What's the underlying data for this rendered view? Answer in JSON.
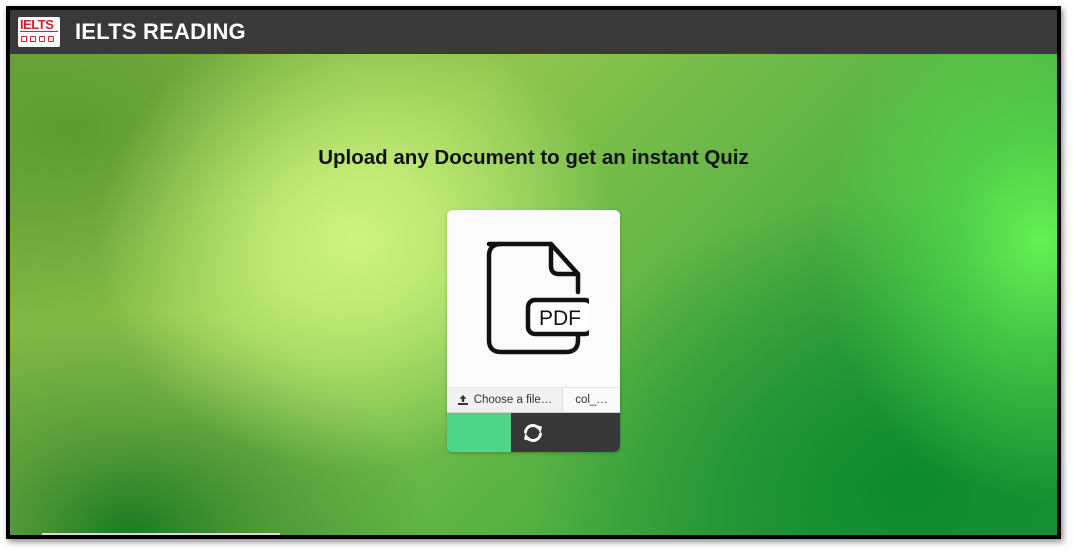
{
  "header": {
    "logo_text": "IELTS",
    "title": "IELTS READING"
  },
  "main": {
    "headline": "Upload any Document to get an instant Quiz"
  },
  "upload_card": {
    "preview_icon": "pdf-file-icon",
    "preview_label": "PDF",
    "choose_button_label": "Choose a file…",
    "choose_button_icon": "upload-icon",
    "selected_file_name": "col_…",
    "submit_button_color": "#4ed588",
    "convert_button_icon": "refresh-icon"
  },
  "colors": {
    "header_bg": "#393939",
    "accent_green": "#4ed588",
    "dark_button": "#373737",
    "logo_red": "#d2232a"
  }
}
